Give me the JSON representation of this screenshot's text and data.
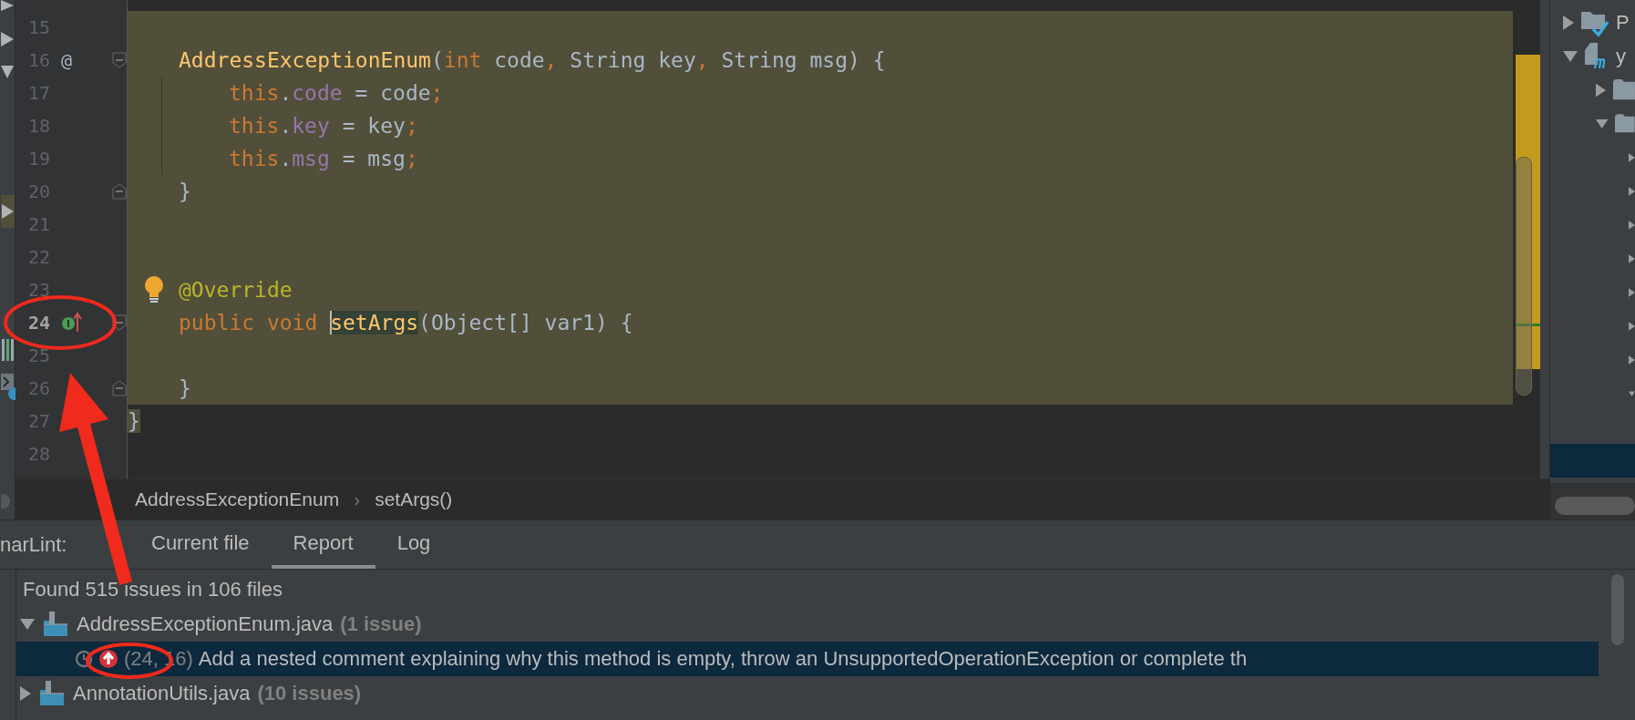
{
  "editor": {
    "lines": [
      {
        "number": "15",
        "shaded": true
      },
      {
        "number": "16",
        "shaded": true,
        "gutter_text": "@",
        "fold_start": true,
        "kind": "member",
        "code": [
          {
            "kind": "decl",
            "text": "AddressExceptionEnum"
          },
          {
            "kind": "plain",
            "text": "("
          },
          {
            "kind": "kw",
            "text": "int"
          },
          {
            "kind": "plain",
            "text": " code"
          },
          {
            "kind": "kw",
            "text": ","
          },
          {
            "kind": "plain",
            "text": " String key"
          },
          {
            "kind": "kw",
            "text": ","
          },
          {
            "kind": "plain",
            "text": " String msg) {"
          }
        ]
      },
      {
        "number": "17",
        "shaded": true,
        "guide": true,
        "kind": "statement",
        "code": [
          {
            "kind": "kw",
            "text": "this"
          },
          {
            "kind": "plain",
            "text": "."
          },
          {
            "kind": "field",
            "text": "code"
          },
          {
            "kind": "plain",
            "text": " = code"
          },
          {
            "kind": "kw",
            "text": ";"
          }
        ]
      },
      {
        "number": "18",
        "shaded": true,
        "guide": true,
        "kind": "statement",
        "code": [
          {
            "kind": "kw",
            "text": "this"
          },
          {
            "kind": "plain",
            "text": "."
          },
          {
            "kind": "field",
            "text": "key"
          },
          {
            "kind": "plain",
            "text": " = key"
          },
          {
            "kind": "kw",
            "text": ";"
          }
        ]
      },
      {
        "number": "19",
        "shaded": true,
        "guide": true,
        "kind": "statement",
        "code": [
          {
            "kind": "kw",
            "text": "this"
          },
          {
            "kind": "plain",
            "text": "."
          },
          {
            "kind": "field",
            "text": "msg"
          },
          {
            "kind": "plain",
            "text": " = msg"
          },
          {
            "kind": "kw",
            "text": ";"
          }
        ]
      },
      {
        "number": "20",
        "shaded": true,
        "fold_end": true,
        "kind": "member",
        "code": [
          {
            "kind": "plain",
            "text": "}"
          }
        ]
      },
      {
        "number": "21",
        "shaded": true
      },
      {
        "number": "22",
        "shaded": true
      },
      {
        "number": "23",
        "shaded": true,
        "bulb": true,
        "kind": "member",
        "code": [
          {
            "kind": "annot",
            "text": "@Override"
          }
        ]
      },
      {
        "number": "24",
        "shaded": true,
        "current": true,
        "implements": true,
        "fold_start": true,
        "kind": "member",
        "code": [
          {
            "kind": "kw",
            "text": "public void "
          },
          {
            "kind": "decl",
            "text": "setArgs",
            "highlighted": true,
            "caret": true
          },
          {
            "kind": "plain",
            "text": "(Object[] var1) {"
          }
        ]
      },
      {
        "number": "25",
        "shaded": true
      },
      {
        "number": "26",
        "shaded": true,
        "fold_end": true,
        "kind": "member",
        "code": [
          {
            "kind": "plain",
            "text": "}"
          }
        ]
      },
      {
        "number": "27",
        "shaded": false,
        "kind": "top",
        "code": [
          {
            "kind": "plain",
            "text": "}",
            "shaded": true
          }
        ]
      },
      {
        "number": "28"
      }
    ]
  },
  "breadcrumbs": {
    "items": [
      "AddressExceptionEnum",
      "setArgs()"
    ],
    "separator": "›"
  },
  "project_tree": [
    {
      "label": "P",
      "kind": "folder-check",
      "expanded": false
    },
    {
      "label": "y",
      "kind": "module",
      "expanded": true,
      "children": [
        {
          "kind": "folder",
          "expanded": false
        },
        {
          "kind": "folder",
          "expanded": true,
          "children": [
            {
              "expanded": false
            },
            {
              "expanded": false
            },
            {
              "expanded": false
            },
            {
              "expanded": false
            },
            {
              "expanded": false
            },
            {
              "expanded": false
            },
            {
              "expanded": false
            },
            {
              "expanded": true,
              "children": [
                {
                  "selected": false
                },
                {
                  "selected": true
                }
              ]
            }
          ]
        }
      ]
    }
  ],
  "sonarlint": {
    "title": "narLint:",
    "tabs": [
      {
        "label": "Current file",
        "selected": false
      },
      {
        "label": "Report",
        "selected": true
      },
      {
        "label": "Log",
        "selected": false
      }
    ],
    "summary": "Found 515 issues in 106 files",
    "files": [
      {
        "name": "AddressExceptionEnum.java",
        "count": "(1 issue)",
        "expanded": true,
        "issues": [
          {
            "position": "(24, 16)",
            "message": "Add a nested comment explaining why this method is empty, throw an UnsupportedOperationException or complete th",
            "selected": true
          }
        ]
      },
      {
        "name": "AnnotationUtils.java",
        "count": "(10 issues)",
        "expanded": false
      }
    ]
  }
}
